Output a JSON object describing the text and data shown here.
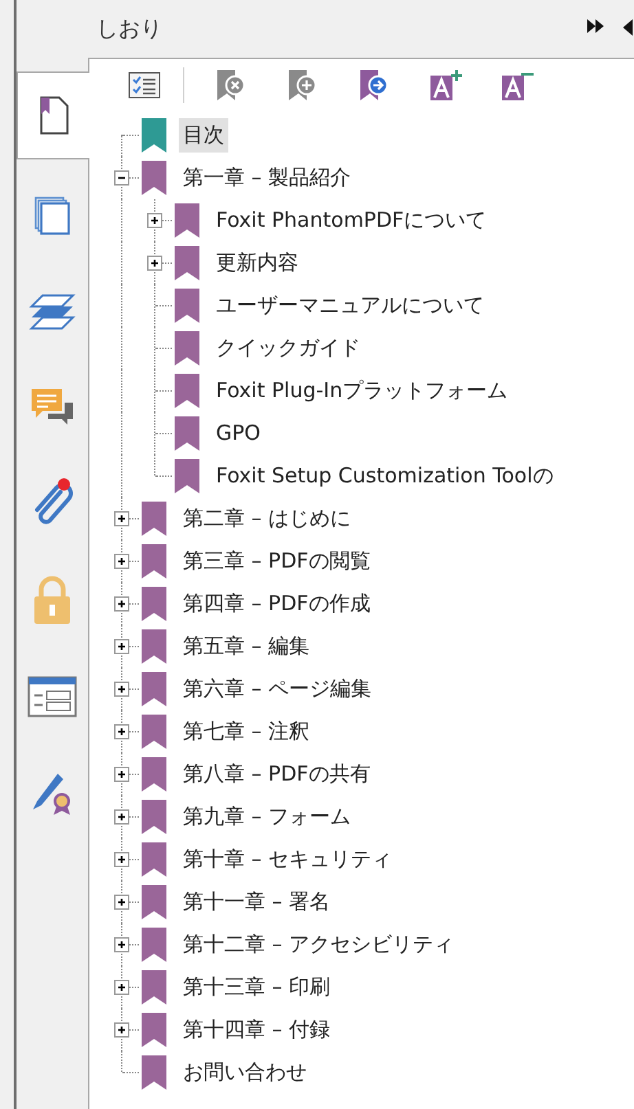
{
  "panel": {
    "title": "しおり"
  },
  "side_tabs": [
    {
      "kind": "bookmarks",
      "selected": true,
      "notify": false
    },
    {
      "kind": "pages",
      "selected": false,
      "notify": false
    },
    {
      "kind": "layers",
      "selected": false,
      "notify": false
    },
    {
      "kind": "comments",
      "selected": false,
      "notify": false
    },
    {
      "kind": "attachments",
      "selected": false,
      "notify": true
    },
    {
      "kind": "security",
      "selected": false,
      "notify": false
    },
    {
      "kind": "forms",
      "selected": false,
      "notify": false
    },
    {
      "kind": "signatures",
      "selected": false,
      "notify": false
    }
  ],
  "tree": [
    {
      "label": "目次",
      "selected": true,
      "kind": "leaf",
      "color": "#2e9a94"
    },
    {
      "label": "第一章 – 製品紹介",
      "selected": false,
      "kind": "branch",
      "expanded": true,
      "color": "#9a6699",
      "children": [
        {
          "label": "Foxit PhantomPDFについて",
          "selected": false,
          "kind": "branch",
          "expanded": false,
          "color": "#9a6699"
        },
        {
          "label": "更新内容",
          "selected": false,
          "kind": "branch",
          "expanded": false,
          "color": "#9a6699"
        },
        {
          "label": "ユーザーマニュアルについて",
          "selected": false,
          "kind": "leaf",
          "color": "#9a6699"
        },
        {
          "label": "クイックガイド",
          "selected": false,
          "kind": "leaf",
          "color": "#9a6699"
        },
        {
          "label": "Foxit Plug-Inプラットフォーム",
          "selected": false,
          "kind": "leaf",
          "color": "#9a6699"
        },
        {
          "label": "GPO",
          "selected": false,
          "kind": "leaf",
          "color": "#9a6699"
        },
        {
          "label": "Foxit Setup Customization Toolの",
          "selected": false,
          "kind": "leaf",
          "color": "#9a6699"
        }
      ]
    },
    {
      "label": "第二章 – はじめに",
      "selected": false,
      "kind": "branch",
      "expanded": false,
      "color": "#9a6699"
    },
    {
      "label": "第三章 – PDFの閲覧",
      "selected": false,
      "kind": "branch",
      "expanded": false,
      "color": "#9a6699"
    },
    {
      "label": "第四章 – PDFの作成",
      "selected": false,
      "kind": "branch",
      "expanded": false,
      "color": "#9a6699"
    },
    {
      "label": "第五章 – 編集",
      "selected": false,
      "kind": "branch",
      "expanded": false,
      "color": "#9a6699"
    },
    {
      "label": "第六章 – ページ編集",
      "selected": false,
      "kind": "branch",
      "expanded": false,
      "color": "#9a6699"
    },
    {
      "label": "第七章 – 注釈",
      "selected": false,
      "kind": "branch",
      "expanded": false,
      "color": "#9a6699"
    },
    {
      "label": "第八章 – PDFの共有",
      "selected": false,
      "kind": "branch",
      "expanded": false,
      "color": "#9a6699"
    },
    {
      "label": "第九章 – フォーム",
      "selected": false,
      "kind": "branch",
      "expanded": false,
      "color": "#9a6699"
    },
    {
      "label": "第十章 – セキュリティ",
      "selected": false,
      "kind": "branch",
      "expanded": false,
      "color": "#9a6699"
    },
    {
      "label": "第十一章 – 署名",
      "selected": false,
      "kind": "branch",
      "expanded": false,
      "color": "#9a6699"
    },
    {
      "label": "第十二章 – アクセシビリティ",
      "selected": false,
      "kind": "branch",
      "expanded": false,
      "color": "#9a6699"
    },
    {
      "label": "第十三章 – 印刷",
      "selected": false,
      "kind": "branch",
      "expanded": false,
      "color": "#9a6699"
    },
    {
      "label": "第十四章 – 付録",
      "selected": false,
      "kind": "branch",
      "expanded": false,
      "color": "#9a6699"
    },
    {
      "label": "お問い合わせ",
      "selected": false,
      "kind": "leaf",
      "color": "#9a6699"
    }
  ]
}
